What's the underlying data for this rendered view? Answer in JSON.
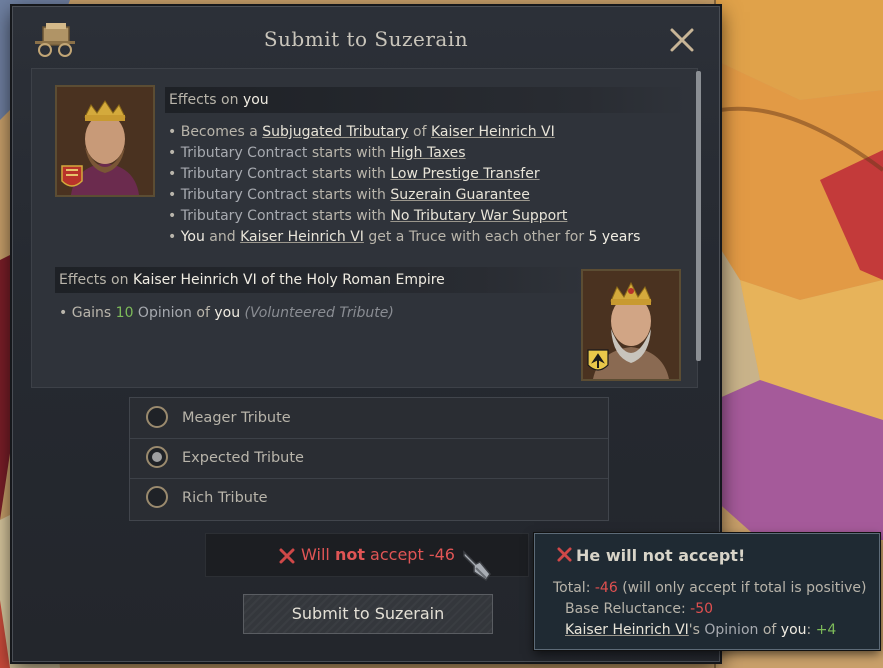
{
  "dialog": {
    "title": "Submit to Suzerain",
    "close_icon": "close-x-icon",
    "header_icon": "wagon-icon"
  },
  "effects_you": {
    "prefix": "Effects on ",
    "target": "you",
    "items": [
      {
        "a": "Becomes a ",
        "b": "Subjugated Tributary",
        "c": " of ",
        "d": "Kaiser Heinrich VI"
      },
      {
        "a": "Tributary Contract",
        "b": " starts with ",
        "c": "High Taxes"
      },
      {
        "a": "Tributary Contract",
        "b": " starts with ",
        "c": "Low Prestige Transfer"
      },
      {
        "a": "Tributary Contract",
        "b": " starts with ",
        "c": "Suzerain Guarantee"
      },
      {
        "a": "Tributary Contract",
        "b": " starts with ",
        "c": "No Tributary War Support"
      },
      {
        "a": "You",
        "b": " and ",
        "c": "Kaiser Heinrich VI",
        "d": " get a Truce with each other for ",
        "e": "5 years"
      }
    ]
  },
  "effects_hre": {
    "prefix": "Effects on ",
    "target": "Kaiser Heinrich VI of the Holy Roman Empire",
    "item": {
      "a": "Gains ",
      "b": "10",
      "c": " Opinion",
      "d": " of ",
      "e": "you",
      "f": "(Volunteered Tribute)"
    }
  },
  "tribute_options": [
    {
      "label": "Meager Tribute",
      "selected": false
    },
    {
      "label": "Expected Tribute",
      "selected": true
    },
    {
      "label": "Rich Tribute",
      "selected": false
    }
  ],
  "acceptance": {
    "a": "Will ",
    "b": "not",
    "c": " accept -46"
  },
  "submit_button": "Submit to Suzerain",
  "tooltip": {
    "title": "He will not accept!",
    "total_label": "Total: ",
    "total_value": "-46",
    "total_note": " (will only accept if total is positive)",
    "base_label": "Base Reluctance: ",
    "base_value": "-50",
    "opinion_name": "Kaiser Heinrich VI",
    "opinion_mid": "'s ",
    "opinion_term": "Opinion",
    "opinion_of": " of ",
    "opinion_you": "you",
    "opinion_colon": ": ",
    "opinion_value": "+4"
  },
  "colors": {
    "negative": "#e05050",
    "positive": "#7dbb5a",
    "panel": "#2f333a"
  }
}
